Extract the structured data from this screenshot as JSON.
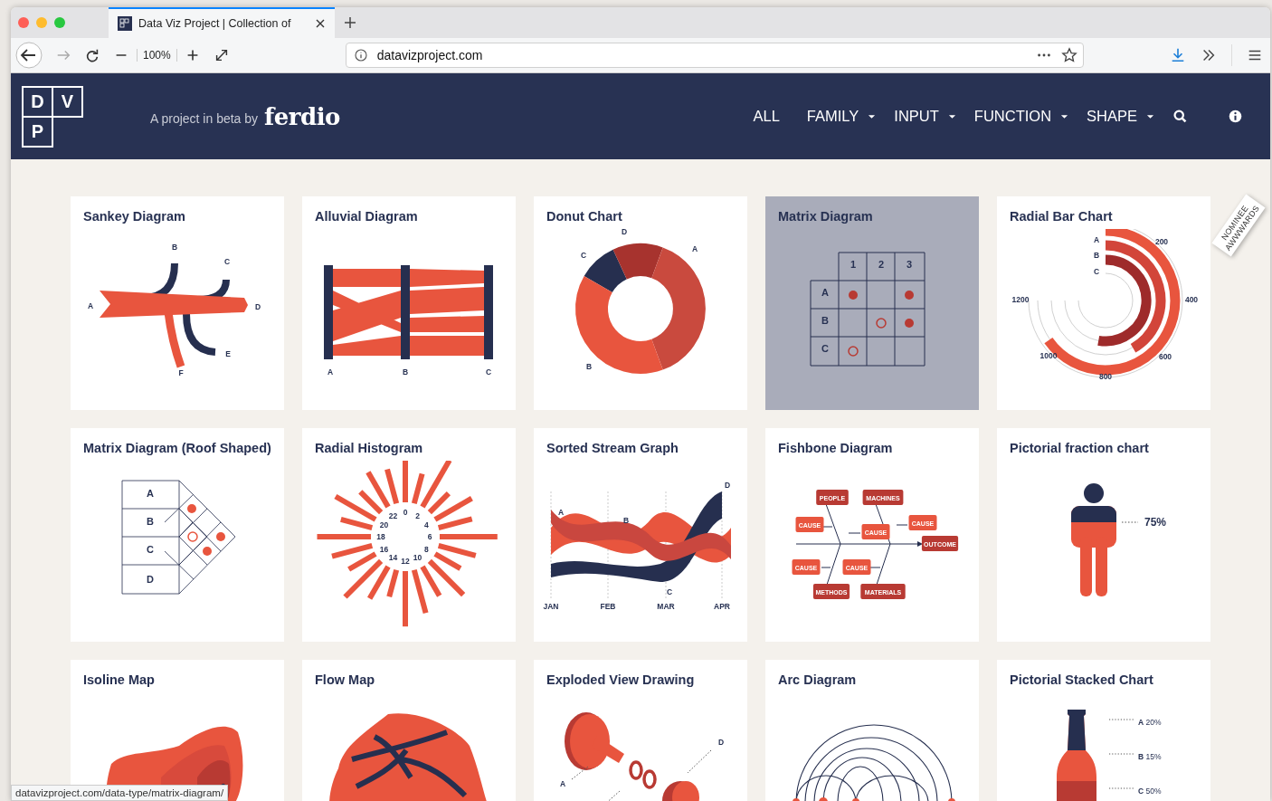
{
  "browser": {
    "tab": {
      "title": "Data Viz Project | Collection of",
      "selected": true
    },
    "zoom": "100%",
    "url": "datavizproject.com",
    "status_url": "datavizproject.com/data-type/matrix-diagram/"
  },
  "header": {
    "logo_letters": [
      "D",
      "V",
      "P"
    ],
    "tagline": "A project in beta by",
    "brand": "ferdio",
    "nav": [
      {
        "label": "ALL",
        "dropdown": false
      },
      {
        "label": "FAMILY",
        "dropdown": true
      },
      {
        "label": "INPUT",
        "dropdown": true
      },
      {
        "label": "FUNCTION",
        "dropdown": true
      },
      {
        "label": "SHAPE",
        "dropdown": true
      }
    ]
  },
  "badge": {
    "top": "NOMINEE",
    "bottom": "AWWWARDS"
  },
  "cards": [
    {
      "title": "Sankey Diagram",
      "kind": "sankey",
      "highlighted": false,
      "labels": [
        "B",
        "C",
        "A",
        "D",
        "E",
        "F"
      ]
    },
    {
      "title": "Alluvial Diagram",
      "kind": "alluvial",
      "highlighted": false,
      "labels": [
        "A",
        "B",
        "C"
      ]
    },
    {
      "title": "Donut Chart",
      "kind": "donut",
      "highlighted": false,
      "labels": [
        "D",
        "A",
        "C",
        "B"
      ]
    },
    {
      "title": "Matrix Diagram",
      "kind": "matrix",
      "highlighted": true,
      "labels": [
        "1",
        "2",
        "3",
        "A",
        "B",
        "C"
      ]
    },
    {
      "title": "Radial Bar Chart",
      "kind": "radialbar",
      "highlighted": false,
      "labels": [
        "A",
        "B",
        "C",
        "200",
        "400",
        "600",
        "800",
        "1000",
        "1200"
      ]
    },
    {
      "title": "Matrix Diagram (Roof Shaped)",
      "kind": "roof",
      "highlighted": false,
      "labels": [
        "A",
        "B",
        "C",
        "D"
      ]
    },
    {
      "title": "Radial Histogram",
      "kind": "radialhist",
      "highlighted": false,
      "labels": [
        "22",
        "0",
        "2",
        "20",
        "4",
        "18",
        "6",
        "16",
        "8",
        "14",
        "12",
        "10"
      ]
    },
    {
      "title": "Sorted Stream Graph",
      "kind": "stream",
      "highlighted": false,
      "labels": [
        "A",
        "B",
        "C",
        "D",
        "JAN",
        "FEB",
        "MAR",
        "APR"
      ]
    },
    {
      "title": "Fishbone Diagram",
      "kind": "fishbone",
      "highlighted": false,
      "labels": [
        "PEOPLE",
        "MACHINES",
        "CAUSE",
        "CAUSE",
        "CAUSE",
        "OUTCOME",
        "CAUSE",
        "CAUSE",
        "METHODS",
        "MATERIALS"
      ]
    },
    {
      "title": "Pictorial fraction chart",
      "kind": "person",
      "highlighted": false,
      "labels": [
        "75%"
      ]
    },
    {
      "title": "Isoline Map",
      "kind": "isoline",
      "highlighted": false
    },
    {
      "title": "Flow Map",
      "kind": "flowmap",
      "highlighted": false
    },
    {
      "title": "Exploded View Drawing",
      "kind": "exploded",
      "highlighted": false,
      "labels": [
        "A",
        "D"
      ]
    },
    {
      "title": "Arc Diagram",
      "kind": "arc",
      "highlighted": false
    },
    {
      "title": "Pictorial Stacked Chart",
      "kind": "bottle",
      "highlighted": false,
      "labels": [
        "**A** 20%",
        "**B** 15%",
        "**C** 50%"
      ]
    }
  ]
}
